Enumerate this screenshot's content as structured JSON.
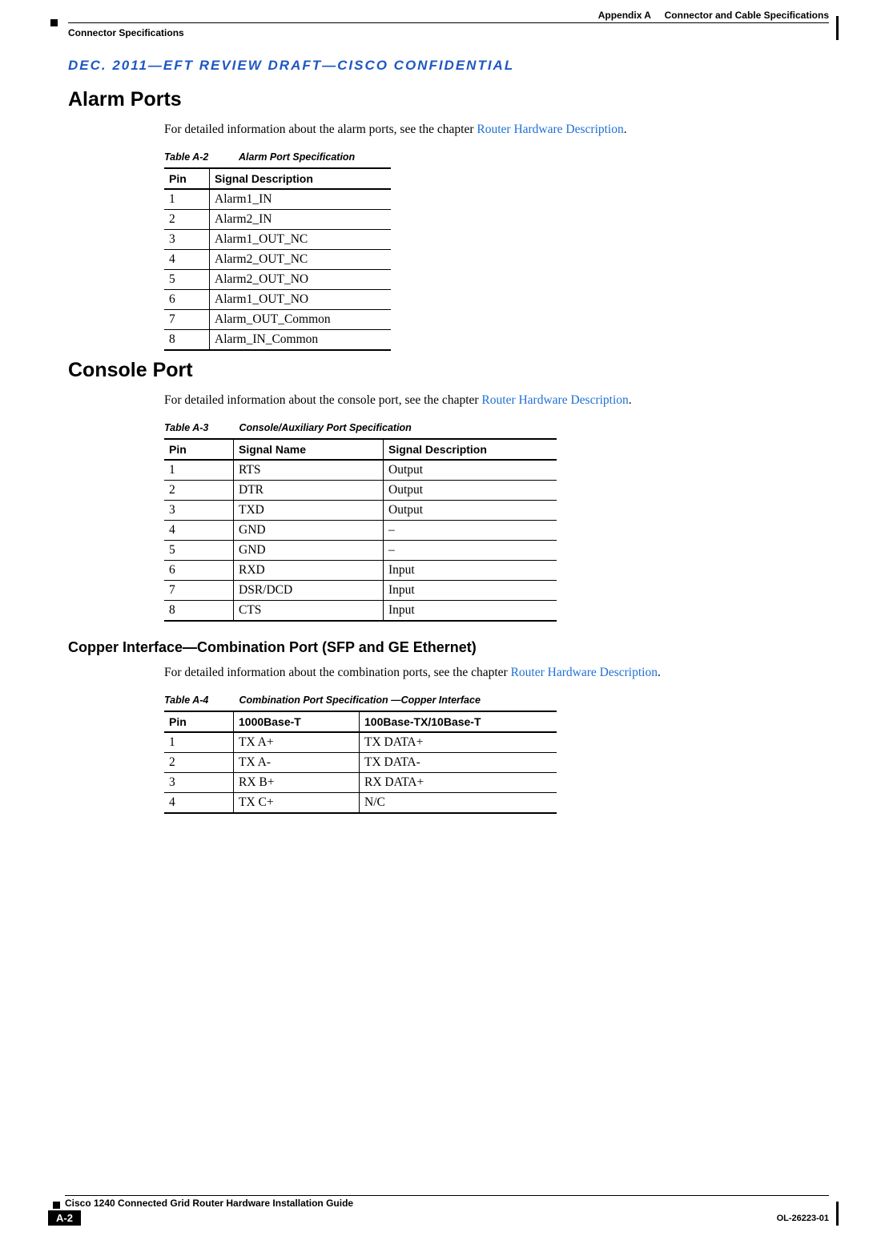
{
  "header": {
    "appendix": "Appendix A",
    "chapter_title": "Connector and Cable Specifications",
    "section_label": "Connector Specifications",
    "confidential": "DEC. 2011—EFT REVIEW DRAFT—CISCO CONFIDENTIAL"
  },
  "section1": {
    "title": "Alarm Ports",
    "intro_prefix": "For detailed information about the alarm ports, see the chapter ",
    "intro_link": "Router Hardware Description",
    "intro_suffix": ".",
    "table_label": "Table A-2",
    "table_title": "Alarm Port Specification",
    "columns": [
      "Pin",
      "Signal Description"
    ],
    "rows": [
      {
        "pin": "1",
        "desc": "Alarm1_IN"
      },
      {
        "pin": "2",
        "desc": "Alarm2_IN"
      },
      {
        "pin": "3",
        "desc": "Alarm1_OUT_NC"
      },
      {
        "pin": "4",
        "desc": "Alarm2_OUT_NC"
      },
      {
        "pin": "5",
        "desc": "Alarm2_OUT_NO"
      },
      {
        "pin": "6",
        "desc": "Alarm1_OUT_NO"
      },
      {
        "pin": "7",
        "desc": "Alarm_OUT_Common"
      },
      {
        "pin": "8",
        "desc": "Alarm_IN_Common"
      }
    ]
  },
  "section2": {
    "title": "Console Port",
    "intro_prefix": "For detailed information about the console port, see the chapter ",
    "intro_link": "Router Hardware Description",
    "intro_suffix": ".",
    "table_label": "Table A-3",
    "table_title": "Console/Auxiliary Port Specification",
    "columns": [
      "Pin",
      "Signal Name",
      "Signal Description"
    ],
    "rows": [
      {
        "pin": "1",
        "name": "RTS",
        "desc": "Output"
      },
      {
        "pin": "2",
        "name": "DTR",
        "desc": "Output"
      },
      {
        "pin": "3",
        "name": "TXD",
        "desc": "Output"
      },
      {
        "pin": "4",
        "name": "GND",
        "desc": "–"
      },
      {
        "pin": "5",
        "name": "GND",
        "desc": "–"
      },
      {
        "pin": "6",
        "name": "RXD",
        "desc": "Input"
      },
      {
        "pin": "7",
        "name": "DSR/DCD",
        "desc": "Input"
      },
      {
        "pin": "8",
        "name": "CTS",
        "desc": "Input"
      }
    ]
  },
  "section3": {
    "title": "Copper Interface—Combination Port (SFP and GE Ethernet)",
    "intro_prefix": "For detailed information about the combination ports, see the chapter ",
    "intro_link": "Router Hardware Description",
    "intro_suffix": ".",
    "table_label": "Table A-4",
    "table_title": "Combination Port Specification —Copper Interface",
    "columns": [
      "Pin",
      "1000Base-T",
      "100Base-TX/10Base-T"
    ],
    "rows": [
      {
        "pin": "1",
        "c1": "TX A+",
        "c2": "TX DATA+"
      },
      {
        "pin": "2",
        "c1": "TX A-",
        "c2": "TX DATA-"
      },
      {
        "pin": "3",
        "c1": "RX B+",
        "c2": "RX DATA+"
      },
      {
        "pin": "4",
        "c1": "TX C+",
        "c2": "N/C"
      }
    ]
  },
  "footer": {
    "book_title": "Cisco 1240 Connected Grid Router Hardware Installation Guide",
    "page_number": "A-2",
    "doc_id": "OL-26223-01"
  }
}
